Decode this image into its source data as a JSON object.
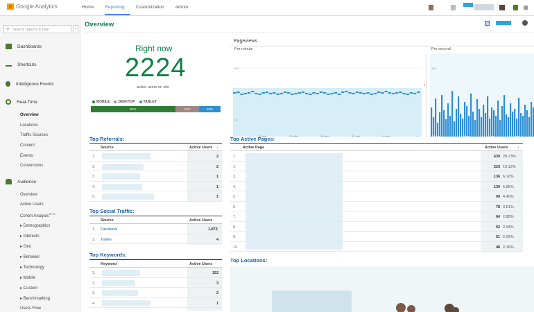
{
  "app": {
    "logo_text": "Google Analytics"
  },
  "topnav": {
    "items": [
      "Home",
      "Reporting",
      "Customization",
      "Admin"
    ],
    "active": "Reporting"
  },
  "sidebar": {
    "search_placeholder": "Search reports & help",
    "collapse_glyph": "‹",
    "sections": {
      "dashboards": "Dashboards",
      "shortcuts": "Shortcuts",
      "intelligence": "Intelligence Events",
      "realtime": "Real-Time",
      "audience": "Audience"
    },
    "realtime_items": [
      "Overview",
      "Locations",
      "Traffic Sources",
      "Content",
      "Events",
      "Conversions"
    ],
    "audience_items": [
      "Overview",
      "Active Users",
      "Cohort Analysis",
      "▸ Demographics",
      "▸ Interests",
      "▸ Geo",
      "▸ Behavior",
      "▸ Technology",
      "▸ Mobile",
      "▸ Custom",
      "▸ Benchmarking",
      "Users Flow"
    ],
    "beta_tag": "BETA"
  },
  "main": {
    "title": "Overview",
    "right_now": {
      "label": "Right now",
      "value": "2224",
      "sub": "active users on site",
      "legend": [
        "MOBILE",
        "DESKTOP",
        "TABLET"
      ],
      "bar_labels": [
        "62%",
        "13%",
        "10%"
      ],
      "colors": {
        "mobile": "#2e7d32",
        "desktop": "#a1887f",
        "tablet": "#2f8fd3"
      }
    },
    "pageviews": {
      "title": "Pageviews",
      "per_minute": "Per minute",
      "per_second": "Per second",
      "minute_ticks": [
        "-26 min",
        "-21 min",
        "-16 min",
        "-11 min",
        "-6 min",
        "-1"
      ],
      "second_ticks": [
        "-20 sec",
        "-15 sec",
        "-10 sec",
        "-5 sec"
      ],
      "y_ticks": [
        "150",
        "75"
      ]
    },
    "top_referrals": {
      "title": "Top Referrals:",
      "col_source": "Source",
      "col_active": "Active Users",
      "sort_glyph": "↓",
      "rows": [
        {
          "n": "1.",
          "v": "2"
        },
        {
          "n": "2.",
          "v": "2"
        },
        {
          "n": "3.",
          "v": "1"
        },
        {
          "n": "4.",
          "v": "1"
        },
        {
          "n": "5.",
          "v": "1"
        }
      ]
    },
    "top_social": {
      "title": "Top Social Traffic:",
      "col_source": "Source",
      "col_active": "Active Users",
      "rows": [
        {
          "n": "1.",
          "name": "Facebook",
          "v": "1,873"
        },
        {
          "n": "2.",
          "name": "Twitter",
          "v": "4"
        }
      ]
    },
    "top_keywords": {
      "title": "Top Keywords:",
      "col_keyword": "Keyword",
      "col_active": "Active Users",
      "rows": [
        {
          "n": "1.",
          "v": "152"
        },
        {
          "n": "2.",
          "v": "3"
        },
        {
          "n": "3.",
          "v": "2"
        },
        {
          "n": "4.",
          "v": "1"
        }
      ]
    },
    "top_pages": {
      "title": "Top Active Pages:",
      "col_page": "Active Page",
      "col_active": "Active Users",
      "rows": [
        {
          "n": "1.",
          "v": "639",
          "p": "28.73%"
        },
        {
          "n": "2.",
          "v": "225",
          "p": "10.12%"
        },
        {
          "n": "3.",
          "v": "136",
          "p": "6.12%"
        },
        {
          "n": "4.",
          "v": "130",
          "p": "5.85%"
        },
        {
          "n": "5.",
          "v": "99",
          "p": "4.45%"
        },
        {
          "n": "6.",
          "v": "78",
          "p": "3.51%"
        },
        {
          "n": "7.",
          "v": "64",
          "p": "2.88%"
        },
        {
          "n": "8.",
          "v": "52",
          "p": "2.34%"
        },
        {
          "n": "9.",
          "v": "51",
          "p": "2.29%"
        },
        {
          "n": "10.",
          "v": "48",
          "p": "2.16%"
        }
      ]
    },
    "top_locations": {
      "title": "Top Locations:"
    }
  }
}
